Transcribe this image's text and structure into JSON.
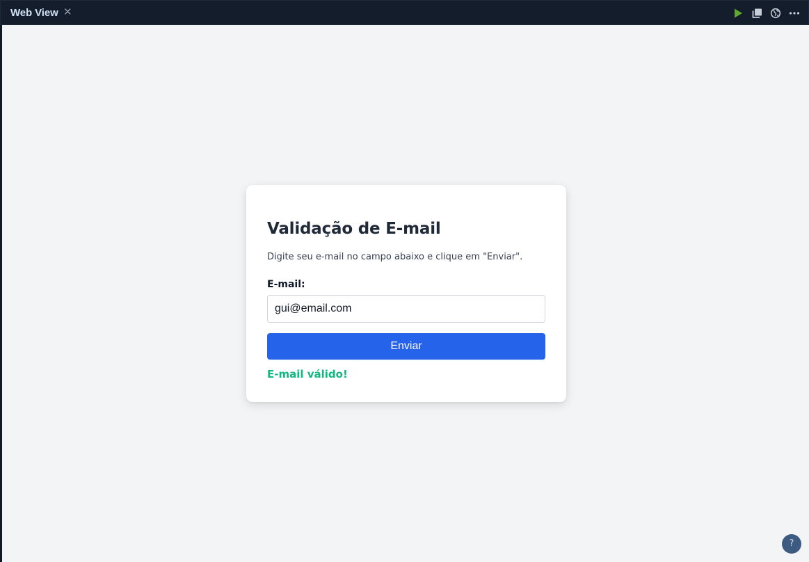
{
  "tab": {
    "title": "Web View",
    "close_symbol": "✕",
    "actions": [
      {
        "icon": "play-icon",
        "color": "#5fa832"
      },
      {
        "icon": "copy-icon",
        "color": "#c7ced8"
      },
      {
        "icon": "globe-icon",
        "color": "#c7ced8"
      },
      {
        "icon": "more-options-icon",
        "color": "#c7ced8"
      }
    ]
  },
  "form": {
    "title": "Validação de E-mail",
    "description": "Digite seu e-mail no campo abaixo e clique em \"Enviar\".",
    "email_label": "E-mail:",
    "email_value": "gui@email.com",
    "submit_label": "Enviar",
    "result_message": "E-mail válido!",
    "result_color": "#10b981",
    "button_color": "#2563eb"
  },
  "help": {
    "symbol": "?"
  }
}
